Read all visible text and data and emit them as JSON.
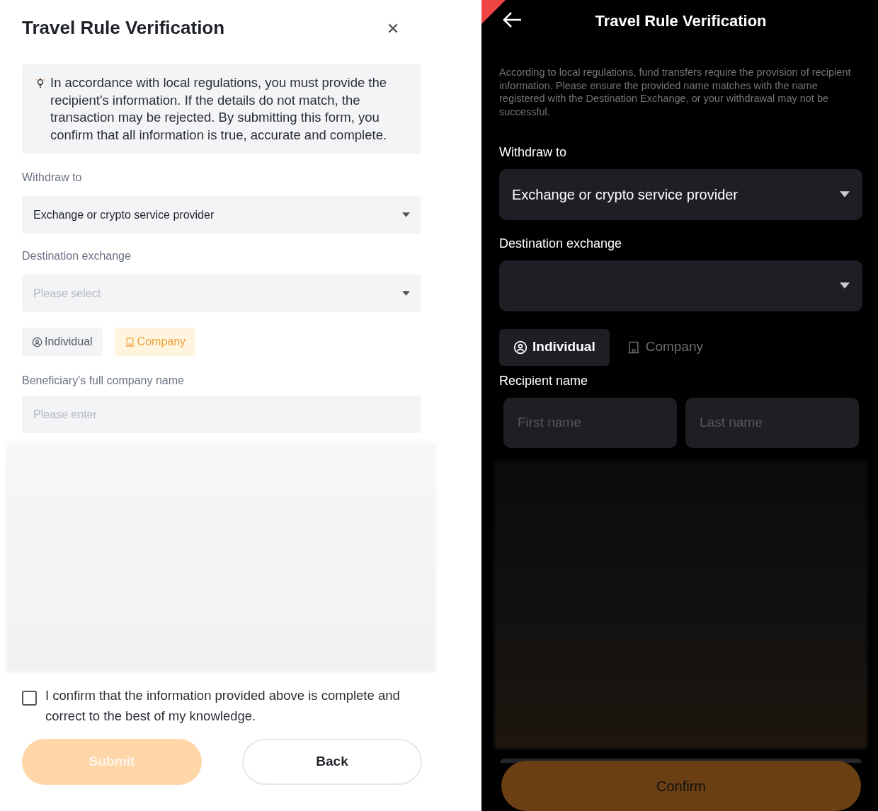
{
  "light_form": {
    "title": "Travel Rule Verification",
    "notice": "In accordance with local regulations, you must provide the recipient's information. If the details do not match, the transaction may be rejected. By submitting this form, you confirm that all information is true, accurate and complete.",
    "withdraw_to": {
      "label": "Withdraw to",
      "value": "Exchange or crypto service provider"
    },
    "destination_exchange": {
      "label": "Destination exchange",
      "placeholder": "Please select"
    },
    "tabs": [
      {
        "label": "Individual",
        "kind": "person",
        "selected": false
      },
      {
        "label": "Company",
        "kind": "building",
        "selected": true
      }
    ],
    "company_name": {
      "label": "Beneficiary's full company name",
      "placeholder": "Please enter"
    },
    "confirmation": {
      "label": "I confirm that the information provided above is complete and correct to the best of my knowledge.",
      "checked": false
    },
    "buttons": [
      {
        "label": "Submit",
        "kind": "primary",
        "disabled": true
      },
      {
        "label": "Back",
        "kind": "secondary",
        "disabled": false
      }
    ]
  },
  "dark_form": {
    "title": "Travel Rule Verification",
    "notice": "According to local regulations, fund transfers require the provision of recipient information. Please ensure the provided name matches with the name registered with the Destination Exchange, or your withdrawal may not be successful.",
    "withdraw_to": {
      "label": "Withdraw to",
      "value": "Exchange or crypto service provider"
    },
    "destination_exchange": {
      "label": "Destination exchange"
    },
    "tabs": [
      {
        "label": "Individual",
        "kind": "person",
        "selected": true
      },
      {
        "label": "Company",
        "kind": "building",
        "selected": false
      }
    ],
    "recipient_name": {
      "label": "Recipient name",
      "first_placeholder": "First name",
      "last_placeholder": "Last name"
    },
    "confirm_button": {
      "label": "Confirm"
    }
  }
}
